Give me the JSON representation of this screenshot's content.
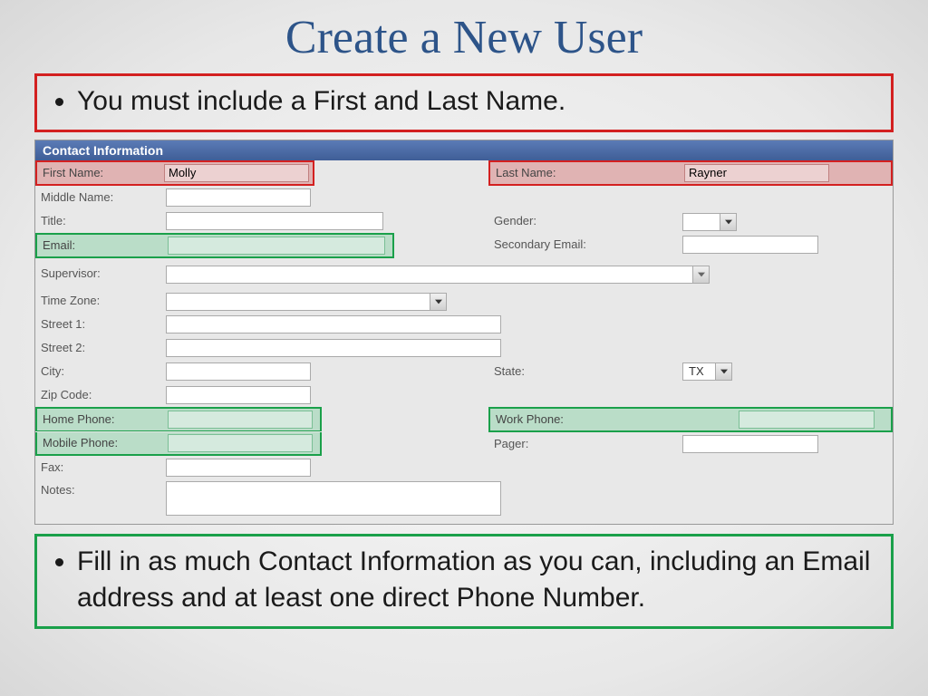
{
  "title": "Create a New User",
  "bullets": {
    "top": "You must include a First and Last Name.",
    "bottom": "Fill in as much Contact Information as you can, including an Email address and at least one direct Phone Number."
  },
  "panel": {
    "header": "Contact Information",
    "fields": {
      "firstName": {
        "label": "First Name:",
        "value": "Molly"
      },
      "lastName": {
        "label": "Last Name:",
        "value": "Rayner"
      },
      "middleName": {
        "label": "Middle Name:",
        "value": ""
      },
      "title": {
        "label": "Title:",
        "value": ""
      },
      "gender": {
        "label": "Gender:",
        "value": ""
      },
      "email": {
        "label": "Email:",
        "value": ""
      },
      "secondaryEmail": {
        "label": "Secondary Email:",
        "value": ""
      },
      "supervisor": {
        "label": "Supervisor:",
        "value": ""
      },
      "timeZone": {
        "label": "Time Zone:",
        "value": ""
      },
      "street1": {
        "label": "Street 1:",
        "value": ""
      },
      "street2": {
        "label": "Street 2:",
        "value": ""
      },
      "city": {
        "label": "City:",
        "value": ""
      },
      "state": {
        "label": "State:",
        "value": "TX"
      },
      "zip": {
        "label": "Zip Code:",
        "value": ""
      },
      "homePhone": {
        "label": "Home Phone:",
        "value": ""
      },
      "workPhone": {
        "label": "Work Phone:",
        "value": ""
      },
      "mobilePhone": {
        "label": "Mobile Phone:",
        "value": ""
      },
      "pager": {
        "label": "Pager:",
        "value": ""
      },
      "fax": {
        "label": "Fax:",
        "value": ""
      },
      "notes": {
        "label": "Notes:",
        "value": ""
      }
    }
  }
}
